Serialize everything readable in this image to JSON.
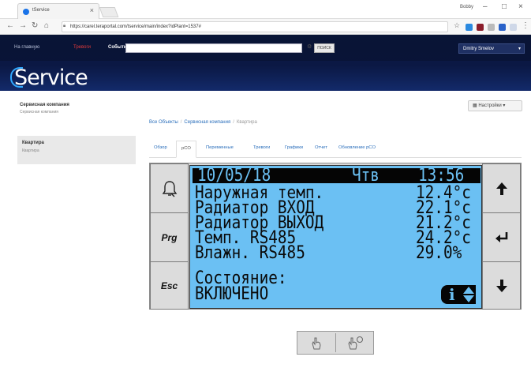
{
  "browser": {
    "tab_title": "tService",
    "url": "https://carel.teraportal.com/tservice/main/index?idPlant=1537#",
    "user_label": "Bobby"
  },
  "site": {
    "nav": {
      "home": "На главную",
      "alarms": "Тревоги",
      "events": "События"
    },
    "search_button": "ПОИСК",
    "user_menu": "Dmitry Smelov",
    "logo_text": "Service"
  },
  "sidebar": {
    "company_name": "Сервисная компания",
    "company_sub": "Сервисная компания",
    "item_title": "Квартира",
    "item_sub": "Квартира"
  },
  "breadcrumb": {
    "all": "Все Объекты",
    "company": "Сервисная компания",
    "current": "Квартира"
  },
  "settings_button": "Настройки",
  "tabs": [
    {
      "label": "Обзор"
    },
    {
      "label": "pCO"
    },
    {
      "label": "Переменные"
    },
    {
      "label": "Тревоги"
    },
    {
      "label": "Графики"
    },
    {
      "label": "Отчет"
    },
    {
      "label": "Обновление pCO"
    }
  ],
  "terminal": {
    "keys": {
      "prg": "Prg",
      "esc": "Esc"
    },
    "lcd": {
      "date": "10/05/18",
      "day": "Чтв",
      "time": "13:56",
      "rows": [
        {
          "label": "Наружная темп.",
          "value": "12.4°c"
        },
        {
          "label": "Радиатор ВХОД",
          "value": "22.1°c"
        },
        {
          "label": "Радиатор ВЫХОД",
          "value": "21.2°c"
        },
        {
          "label": "Темп. RS485",
          "value": "24.2°c"
        },
        {
          "label": "Влажн. RS485",
          "value": "29.0%"
        }
      ],
      "status_label": "Состояние:",
      "status_value": "ВКЛЮЧЕНО",
      "info_glyph": "i"
    }
  },
  "colors": {
    "lcd_background": "#6bc0f3",
    "header_background": "#0c1a43",
    "link": "#2a6ebb",
    "alarm": "#e23a3a"
  }
}
